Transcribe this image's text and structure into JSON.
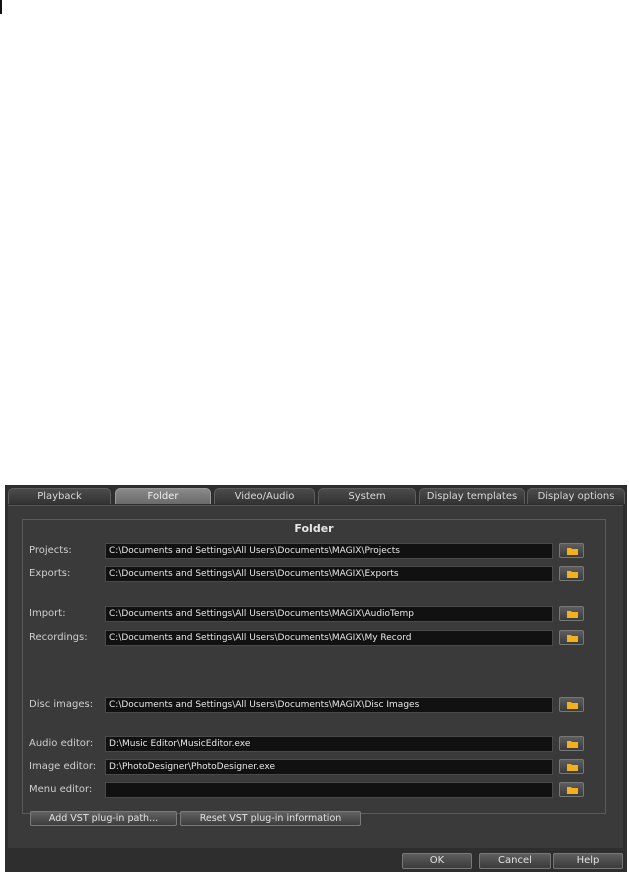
{
  "tabs": [
    {
      "label": "Playback",
      "active": false
    },
    {
      "label": "Folder",
      "active": true
    },
    {
      "label": "Video/Audio",
      "active": false
    },
    {
      "label": "System",
      "active": false
    },
    {
      "label": "Display templates",
      "active": false
    },
    {
      "label": "Display options",
      "active": false
    }
  ],
  "group_title": "Folder",
  "rows": {
    "projects": {
      "label": "Projects:",
      "value": "C:\\Documents and Settings\\All Users\\Documents\\MAGIX\\Projects"
    },
    "exports": {
      "label": "Exports:",
      "value": "C:\\Documents and Settings\\All Users\\Documents\\MAGIX\\Exports"
    },
    "import": {
      "label": "Import:",
      "value": "C:\\Documents and Settings\\All Users\\Documents\\MAGIX\\AudioTemp"
    },
    "recordings": {
      "label": "Recordings:",
      "value": "C:\\Documents and Settings\\All Users\\Documents\\MAGIX\\My Record"
    },
    "disc_images": {
      "label": "Disc images:",
      "value": "C:\\Documents and Settings\\All Users\\Documents\\MAGIX\\Disc Images"
    },
    "audio_editor": {
      "label": "Audio editor:",
      "value": "D:\\Music Editor\\MusicEditor.exe"
    },
    "image_editor": {
      "label": "Image editor:",
      "value": "D:\\PhotoDesigner\\PhotoDesigner.exe"
    },
    "menu_editor": {
      "label": "Menu editor:",
      "value": ""
    }
  },
  "buttons": {
    "add_vst": "Add VST plug-in path...",
    "reset_vst": "Reset VST plug-in information",
    "ok": "OK",
    "cancel": "Cancel",
    "help": "Help"
  },
  "icons": {
    "browse": "folder-icon"
  },
  "colors": {
    "folder_icon": "#f2b01e",
    "dialog_bg": "#2e2e2e",
    "field_bg": "#111111"
  }
}
